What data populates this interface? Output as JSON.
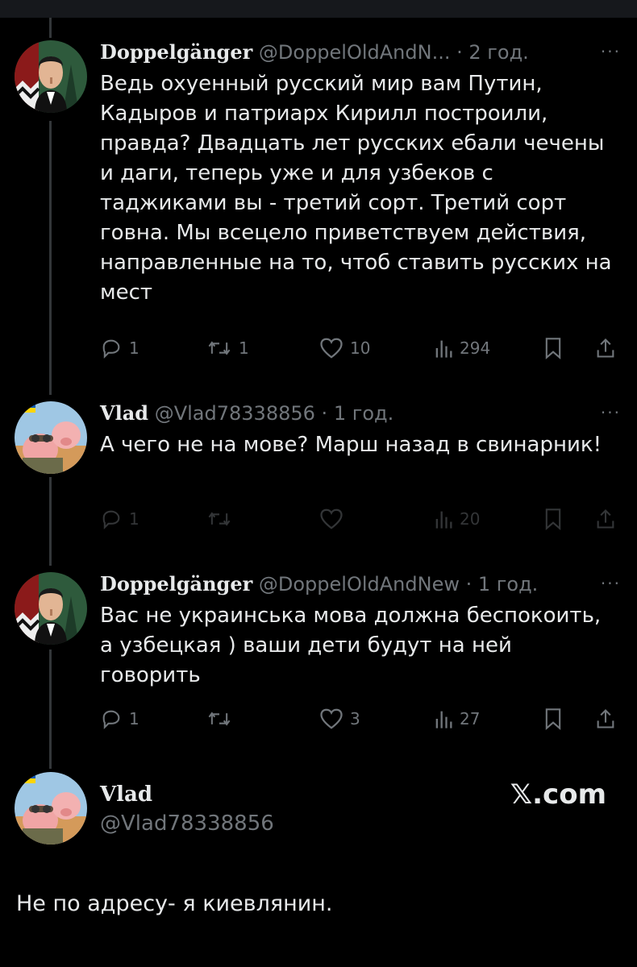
{
  "tweets": [
    {
      "name": "Doppelgänger",
      "handle": "@DoppelOldAndN...",
      "time": "2 год.",
      "text": "Ведь охуенный русский мир вам Путин, Кадыров и патриарх Кирилл построили, правда? Двадцать лет русских ебали чечены и даги, теперь уже и для узбеков с таджиками вы - третий сорт. Третий сорт говна. Мы всецело приветствуем действия, направленные на то, чтоб ставить русских на мест",
      "replies": "1",
      "reposts": "1",
      "likes": "10",
      "views": "294"
    },
    {
      "name": "Vlad",
      "handle": "@Vlad78338856",
      "time": "1 год.",
      "text": "А чего не на мове? Марш назад в свинарник!",
      "replies": "1",
      "reposts": "",
      "likes": "",
      "views": "20"
    },
    {
      "name": "Doppelgänger",
      "handle": "@DoppelOldAndNew",
      "time": "1 год.",
      "text": "Вас не украинська мова должна беспокоить, а узбецкая ) ваши дети будут на ней говорить",
      "replies": "1",
      "reposts": "",
      "likes": "3",
      "views": "27"
    }
  ],
  "last": {
    "name": "Vlad",
    "handle": "@Vlad78338856",
    "text": "Не по адресу- я киевлянин.",
    "brand": "𝕏.com"
  },
  "icons": {
    "reply": "reply-icon",
    "repost": "repost-icon",
    "like": "heart-icon",
    "views": "views-icon",
    "bookmark": "bookmark-icon",
    "share": "share-icon",
    "more": "more-icon"
  },
  "colors": {
    "background": "#000000",
    "text": "#e7e9ea",
    "muted": "#71767b",
    "line": "#333639"
  }
}
